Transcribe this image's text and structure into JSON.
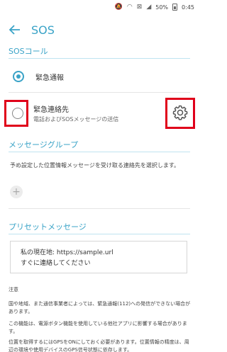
{
  "status": {
    "battery": "50%",
    "time": "0:45"
  },
  "appbar": {
    "title": "SOS"
  },
  "sos_section": {
    "title": "SOSコール",
    "option1": "緊急通報",
    "option2_title": "緊急連絡先",
    "option2_sub": "電話およびSOSメッセージの送信"
  },
  "group_section": {
    "title": "メッセージグループ",
    "desc": "予め設定した位置情報メッセージを受け取る連絡先を選択します。",
    "add_label": "+"
  },
  "preset_section": {
    "title": "プリセットメッセージ",
    "line1": "私の現在地: https://sample.url",
    "line2": "すぐに連絡してください"
  },
  "notes": {
    "title": "注意",
    "p1": "国や地域、また通信事業者によっては、緊急通報(112)への発信ができない場合があります。",
    "p2": "この機能は、電源ボタン機能を使用している他社アプリに影響する場合があります。",
    "p3": "位置を取得するにはGPSをONにしておく必要があります。位置情報の精度は、周辺の環境や使用デバイスのGPS信号状態に依存します。"
  },
  "colors": {
    "accent": "#3aa3c7",
    "highlight": "#e0001a"
  }
}
